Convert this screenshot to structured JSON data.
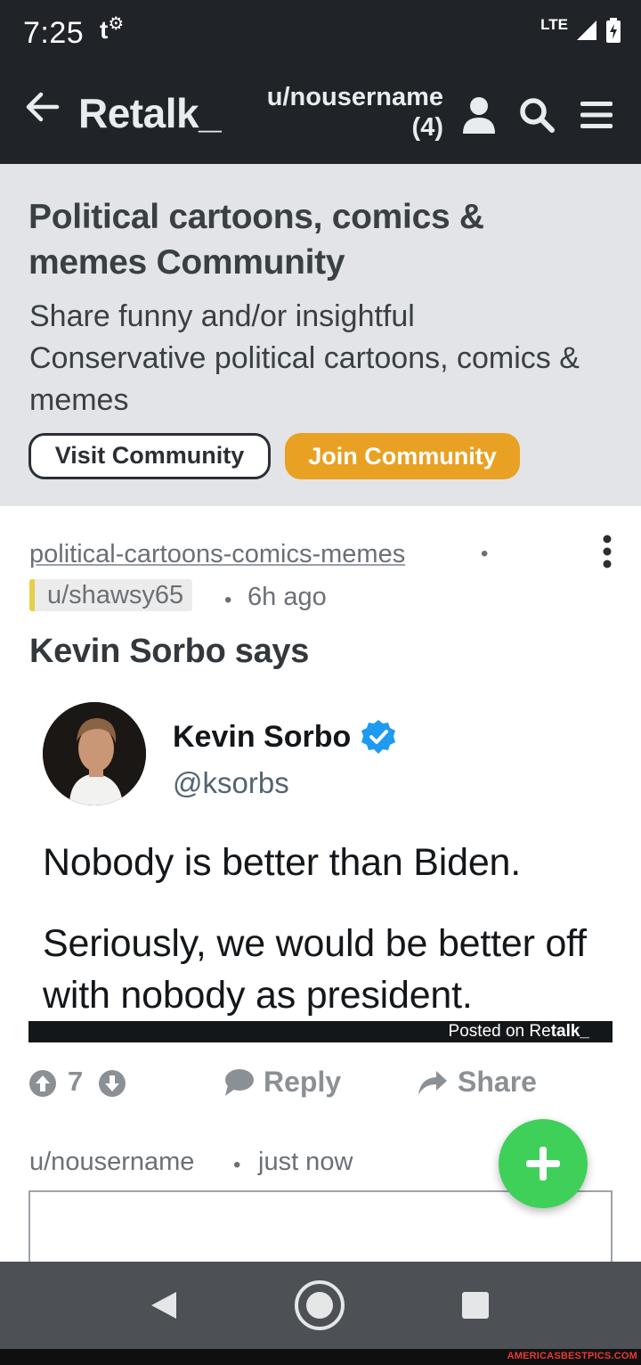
{
  "status_bar": {
    "time": "7:25",
    "carrier_glyph": "t",
    "network": "LTE",
    "icons": [
      "signal-icon",
      "battery-charging-icon"
    ]
  },
  "header": {
    "app_title": "Retalk_",
    "username": "u/nousername",
    "notification_count": "(4)",
    "icons": [
      "back-arrow-icon",
      "person-icon",
      "search-icon",
      "menu-icon"
    ]
  },
  "community": {
    "title": "Political cartoons, comics & memes Community",
    "description": "Share funny and/or insightful Conservative political cartoons, comics & memes",
    "visit_label": "Visit Community",
    "join_label": "Join Community",
    "colors": {
      "banner_bg": "#e2e4e7",
      "join_button": "#e9a123"
    }
  },
  "post": {
    "community_slug": "political-cartoons-comics-memes",
    "separator": "•",
    "author": "u/shawsy65",
    "time_ago": "6h ago",
    "title": "Kevin Sorbo says",
    "embed": {
      "name": "Kevin Sorbo",
      "handle": "@ksorbs",
      "text_line_1": "Nobody is better than Biden.",
      "text_line_2": "Seriously, we would be better off with nobody as president.",
      "footer_prefix": "Posted on Re",
      "footer_brand": "talk_"
    },
    "votes": "7",
    "reply_label": "Reply",
    "share_label": "Share"
  },
  "composer": {
    "user": "u/nousername",
    "time": "just now"
  },
  "fab": {
    "icon": "plus-icon",
    "color": "#3fd05a"
  },
  "nav_bar": {
    "icons": [
      "nav-back-icon",
      "nav-home-icon",
      "nav-recents-icon"
    ]
  },
  "watermark": "AMERICASBESTPICS.COM"
}
